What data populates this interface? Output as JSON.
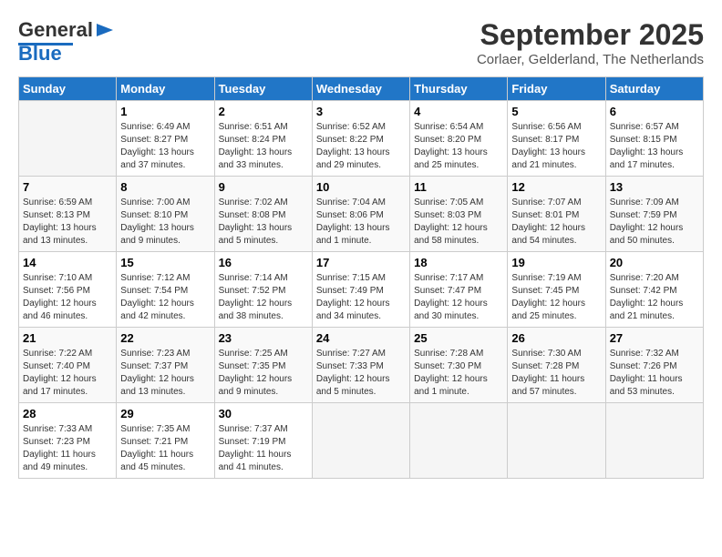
{
  "header": {
    "logo_general": "General",
    "logo_blue": "Blue",
    "month_title": "September 2025",
    "subtitle": "Corlaer, Gelderland, The Netherlands"
  },
  "calendar": {
    "weekdays": [
      "Sunday",
      "Monday",
      "Tuesday",
      "Wednesday",
      "Thursday",
      "Friday",
      "Saturday"
    ],
    "weeks": [
      [
        {
          "day": "",
          "sunrise": "",
          "sunset": "",
          "daylight": ""
        },
        {
          "day": "1",
          "sunrise": "Sunrise: 6:49 AM",
          "sunset": "Sunset: 8:27 PM",
          "daylight": "Daylight: 13 hours and 37 minutes."
        },
        {
          "day": "2",
          "sunrise": "Sunrise: 6:51 AM",
          "sunset": "Sunset: 8:24 PM",
          "daylight": "Daylight: 13 hours and 33 minutes."
        },
        {
          "day": "3",
          "sunrise": "Sunrise: 6:52 AM",
          "sunset": "Sunset: 8:22 PM",
          "daylight": "Daylight: 13 hours and 29 minutes."
        },
        {
          "day": "4",
          "sunrise": "Sunrise: 6:54 AM",
          "sunset": "Sunset: 8:20 PM",
          "daylight": "Daylight: 13 hours and 25 minutes."
        },
        {
          "day": "5",
          "sunrise": "Sunrise: 6:56 AM",
          "sunset": "Sunset: 8:17 PM",
          "daylight": "Daylight: 13 hours and 21 minutes."
        },
        {
          "day": "6",
          "sunrise": "Sunrise: 6:57 AM",
          "sunset": "Sunset: 8:15 PM",
          "daylight": "Daylight: 13 hours and 17 minutes."
        }
      ],
      [
        {
          "day": "7",
          "sunrise": "Sunrise: 6:59 AM",
          "sunset": "Sunset: 8:13 PM",
          "daylight": "Daylight: 13 hours and 13 minutes."
        },
        {
          "day": "8",
          "sunrise": "Sunrise: 7:00 AM",
          "sunset": "Sunset: 8:10 PM",
          "daylight": "Daylight: 13 hours and 9 minutes."
        },
        {
          "day": "9",
          "sunrise": "Sunrise: 7:02 AM",
          "sunset": "Sunset: 8:08 PM",
          "daylight": "Daylight: 13 hours and 5 minutes."
        },
        {
          "day": "10",
          "sunrise": "Sunrise: 7:04 AM",
          "sunset": "Sunset: 8:06 PM",
          "daylight": "Daylight: 13 hours and 1 minute."
        },
        {
          "day": "11",
          "sunrise": "Sunrise: 7:05 AM",
          "sunset": "Sunset: 8:03 PM",
          "daylight": "Daylight: 12 hours and 58 minutes."
        },
        {
          "day": "12",
          "sunrise": "Sunrise: 7:07 AM",
          "sunset": "Sunset: 8:01 PM",
          "daylight": "Daylight: 12 hours and 54 minutes."
        },
        {
          "day": "13",
          "sunrise": "Sunrise: 7:09 AM",
          "sunset": "Sunset: 7:59 PM",
          "daylight": "Daylight: 12 hours and 50 minutes."
        }
      ],
      [
        {
          "day": "14",
          "sunrise": "Sunrise: 7:10 AM",
          "sunset": "Sunset: 7:56 PM",
          "daylight": "Daylight: 12 hours and 46 minutes."
        },
        {
          "day": "15",
          "sunrise": "Sunrise: 7:12 AM",
          "sunset": "Sunset: 7:54 PM",
          "daylight": "Daylight: 12 hours and 42 minutes."
        },
        {
          "day": "16",
          "sunrise": "Sunrise: 7:14 AM",
          "sunset": "Sunset: 7:52 PM",
          "daylight": "Daylight: 12 hours and 38 minutes."
        },
        {
          "day": "17",
          "sunrise": "Sunrise: 7:15 AM",
          "sunset": "Sunset: 7:49 PM",
          "daylight": "Daylight: 12 hours and 34 minutes."
        },
        {
          "day": "18",
          "sunrise": "Sunrise: 7:17 AM",
          "sunset": "Sunset: 7:47 PM",
          "daylight": "Daylight: 12 hours and 30 minutes."
        },
        {
          "day": "19",
          "sunrise": "Sunrise: 7:19 AM",
          "sunset": "Sunset: 7:45 PM",
          "daylight": "Daylight: 12 hours and 25 minutes."
        },
        {
          "day": "20",
          "sunrise": "Sunrise: 7:20 AM",
          "sunset": "Sunset: 7:42 PM",
          "daylight": "Daylight: 12 hours and 21 minutes."
        }
      ],
      [
        {
          "day": "21",
          "sunrise": "Sunrise: 7:22 AM",
          "sunset": "Sunset: 7:40 PM",
          "daylight": "Daylight: 12 hours and 17 minutes."
        },
        {
          "day": "22",
          "sunrise": "Sunrise: 7:23 AM",
          "sunset": "Sunset: 7:37 PM",
          "daylight": "Daylight: 12 hours and 13 minutes."
        },
        {
          "day": "23",
          "sunrise": "Sunrise: 7:25 AM",
          "sunset": "Sunset: 7:35 PM",
          "daylight": "Daylight: 12 hours and 9 minutes."
        },
        {
          "day": "24",
          "sunrise": "Sunrise: 7:27 AM",
          "sunset": "Sunset: 7:33 PM",
          "daylight": "Daylight: 12 hours and 5 minutes."
        },
        {
          "day": "25",
          "sunrise": "Sunrise: 7:28 AM",
          "sunset": "Sunset: 7:30 PM",
          "daylight": "Daylight: 12 hours and 1 minute."
        },
        {
          "day": "26",
          "sunrise": "Sunrise: 7:30 AM",
          "sunset": "Sunset: 7:28 PM",
          "daylight": "Daylight: 11 hours and 57 minutes."
        },
        {
          "day": "27",
          "sunrise": "Sunrise: 7:32 AM",
          "sunset": "Sunset: 7:26 PM",
          "daylight": "Daylight: 11 hours and 53 minutes."
        }
      ],
      [
        {
          "day": "28",
          "sunrise": "Sunrise: 7:33 AM",
          "sunset": "Sunset: 7:23 PM",
          "daylight": "Daylight: 11 hours and 49 minutes."
        },
        {
          "day": "29",
          "sunrise": "Sunrise: 7:35 AM",
          "sunset": "Sunset: 7:21 PM",
          "daylight": "Daylight: 11 hours and 45 minutes."
        },
        {
          "day": "30",
          "sunrise": "Sunrise: 7:37 AM",
          "sunset": "Sunset: 7:19 PM",
          "daylight": "Daylight: 11 hours and 41 minutes."
        },
        {
          "day": "",
          "sunrise": "",
          "sunset": "",
          "daylight": ""
        },
        {
          "day": "",
          "sunrise": "",
          "sunset": "",
          "daylight": ""
        },
        {
          "day": "",
          "sunrise": "",
          "sunset": "",
          "daylight": ""
        },
        {
          "day": "",
          "sunrise": "",
          "sunset": "",
          "daylight": ""
        }
      ]
    ]
  }
}
